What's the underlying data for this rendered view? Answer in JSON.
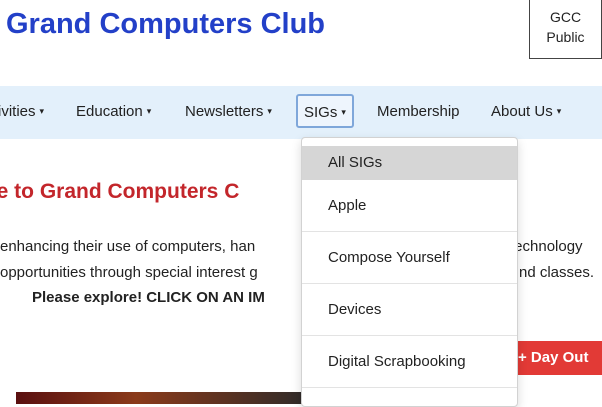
{
  "header": {
    "title": "Grand Computers Club",
    "badge_line1": "GCC",
    "badge_line2": "Public"
  },
  "nav": {
    "items": [
      {
        "label": "ivities",
        "caret": "▾"
      },
      {
        "label": "Education",
        "caret": "▾"
      },
      {
        "label": "Newsletters",
        "caret": "▾"
      },
      {
        "label": "SIGs",
        "caret": "▾"
      },
      {
        "label": "Membership",
        "caret": ""
      },
      {
        "label": "About Us",
        "caret": "▾"
      }
    ]
  },
  "main": {
    "welcome": "me to Grand Computers C",
    "line1_left": "enhancing their use of computers, han",
    "line1_right": "technology",
    "line2_left": "opportunities through special interest g",
    "line2_right": "nd classes.",
    "line3": "Please explore!   CLICK ON AN IM",
    "red_button": "+ Day Out"
  },
  "dropdown": {
    "items": [
      "All SIGs",
      "Apple",
      "Compose Yourself",
      "Devices",
      "Digital Scrapbooking"
    ]
  },
  "colors": {
    "title": "#2340c8",
    "nav_bg": "#e3f0fb",
    "welcome": "#c3262b",
    "button": "#e23a36"
  }
}
